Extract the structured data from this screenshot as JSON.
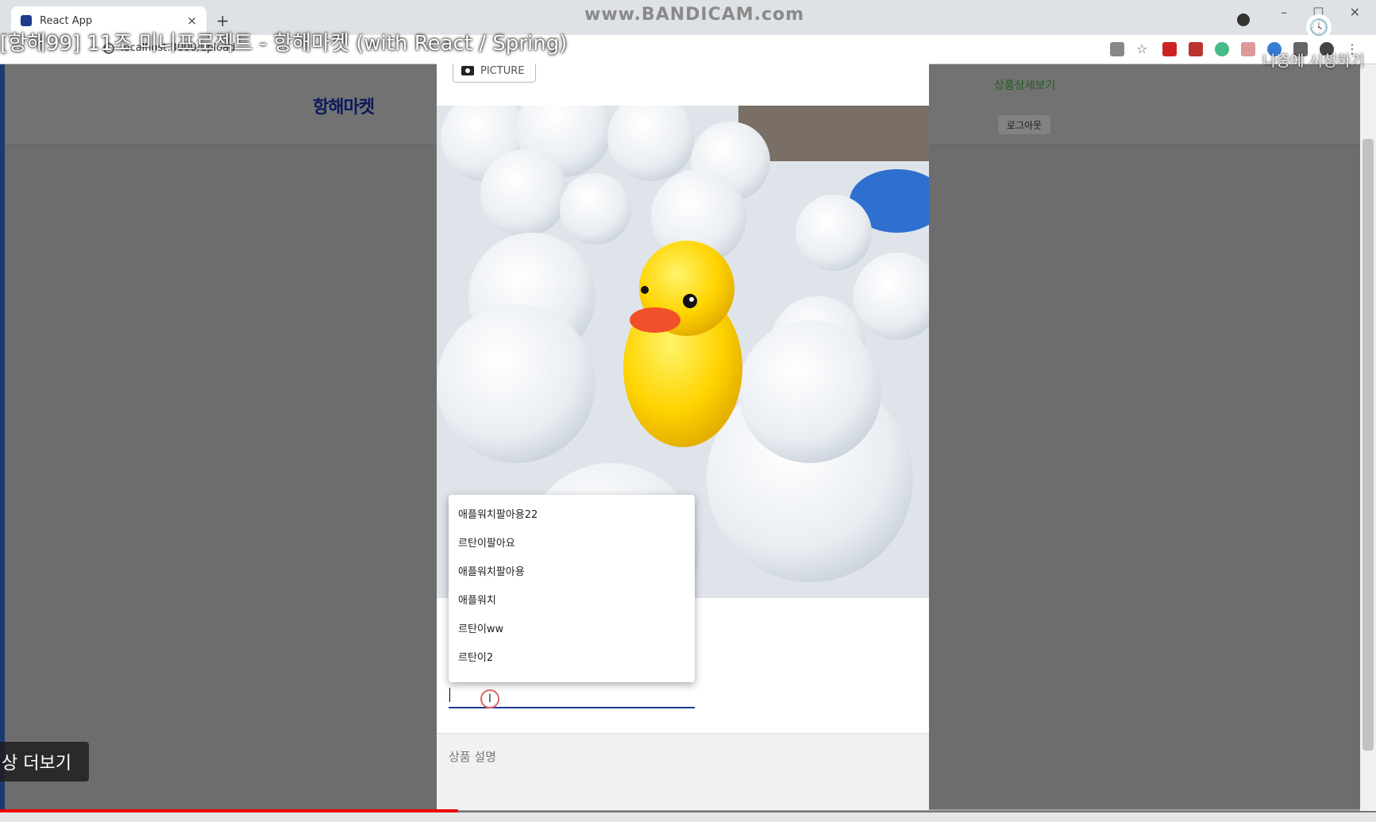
{
  "browser": {
    "tab_title": "React App",
    "tab_close": "×",
    "new_tab": "+",
    "url": "localhost:3000/upload",
    "watermark": "www.BANDICAM.com",
    "window_controls": [
      "–",
      "☐",
      "✕"
    ]
  },
  "video": {
    "title": "[항해99] 11조 미니프로젝트 - 항해마켓 (with React / Spring)",
    "watch_later": "나중에 시청하기",
    "more_label": "상 더보기",
    "progress": 0.333
  },
  "header": {
    "logo": "항해마켓",
    "nav_detail": "상품상세보기",
    "logout": "로그아웃"
  },
  "modal": {
    "upload_label": "PICTURE",
    "suggestions": [
      "애플워치팔아용22",
      "르탄이팔아요",
      "애플워치팔아용",
      "애플워치",
      "르탄이ww",
      "르탄이2"
    ],
    "title_value": "",
    "description_placeholder": "상품 설명"
  },
  "colors": {
    "accent": "#1e3a8a",
    "logo": "#0a1a5a",
    "nav_link": "#1f5e22",
    "progress": "#e00000"
  }
}
